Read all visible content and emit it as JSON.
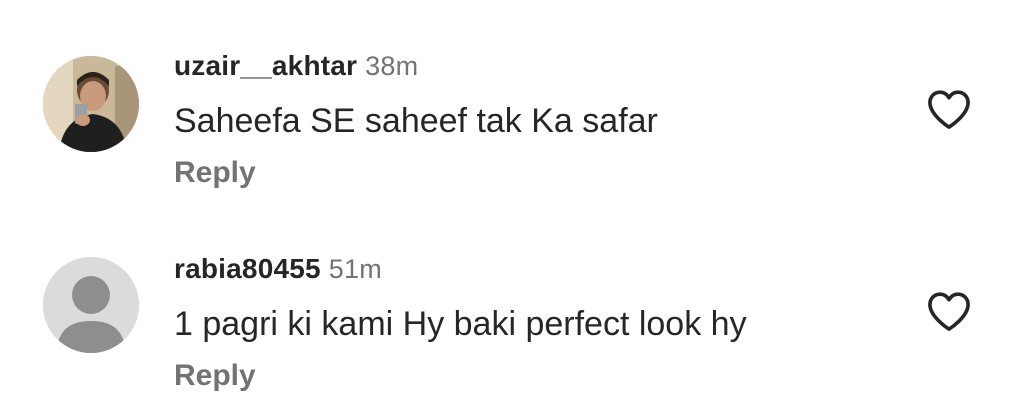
{
  "comments": [
    {
      "username": "uzair__akhtar",
      "time": "38m",
      "text": "Saheefa SE saheef tak Ka safar",
      "reply_label": "Reply",
      "avatar_icon": "user-photo-avatar",
      "like_icon": "heart-outline-icon"
    },
    {
      "username": "rabia80455",
      "time": "51m",
      "text": "1 pagri ki kami Hy baki perfect look hy",
      "reply_label": "Reply",
      "avatar_icon": "default-user-avatar",
      "like_icon": "heart-outline-icon"
    }
  ],
  "colors": {
    "primary_text": "#262626",
    "secondary_text": "#737373",
    "background": "#ffffff"
  }
}
